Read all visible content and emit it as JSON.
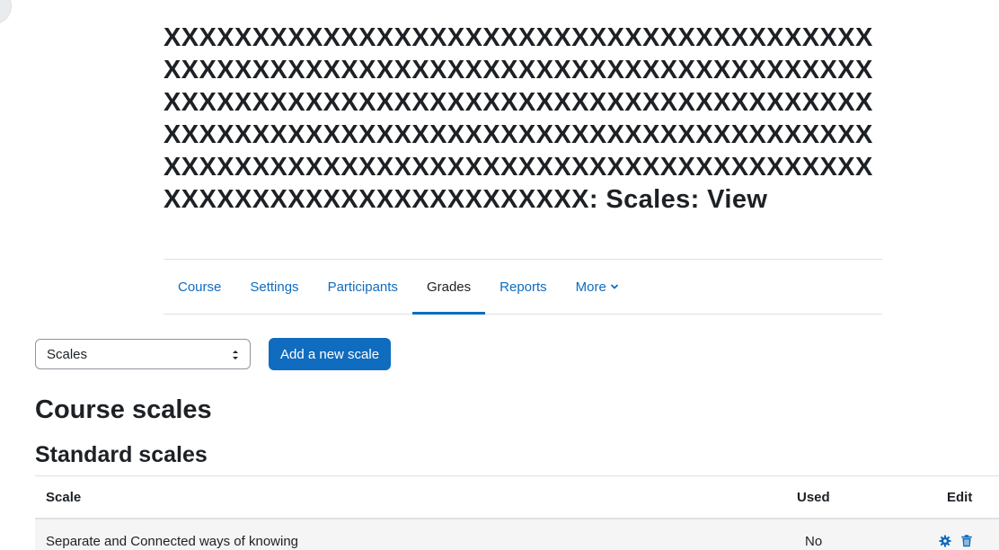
{
  "header": {
    "title": "XXXXXXXXXXXXXXXXXXXXXXXXXXXXXXXXXXXXXXXXXXXXXXXXXXXXXXXXXXXXXXXXXXXXXXXXXXXXXXXXXXXXXXXXXXXXXXXXXXXXXXXXXXXXXXXXXXXXXXXXXXXXXXXXXXXXXXXXXXXXXXXXXXXXXXXXXXXXXXXXXXXXXXXXXXXXXXXXXXXXXXXXXXXXXXXXXXXXXXXXXXXXXXXXXXXXXXXXXXXXXXXX: Scales: View"
  },
  "nav": {
    "items": [
      {
        "label": "Course"
      },
      {
        "label": "Settings"
      },
      {
        "label": "Participants"
      },
      {
        "label": "Grades"
      },
      {
        "label": "Reports"
      },
      {
        "label": "More"
      }
    ],
    "active": "Grades"
  },
  "toolbar": {
    "select_value": "Scales",
    "add_button_label": "Add a new scale"
  },
  "headings": {
    "course_scales": "Course scales",
    "standard_scales": "Standard scales"
  },
  "table": {
    "columns": {
      "scale": "Scale",
      "used": "Used",
      "edit": "Edit"
    },
    "rows": [
      {
        "scale": "Separate and Connected ways of knowing",
        "used": "No"
      }
    ]
  },
  "colors": {
    "accent": "#0f6cbf",
    "text": "#1d2125",
    "row_bg": "#f5f5f5"
  },
  "icons": {
    "settings": "gear-icon",
    "delete": "trash-icon",
    "more": "chevron-down-icon"
  }
}
